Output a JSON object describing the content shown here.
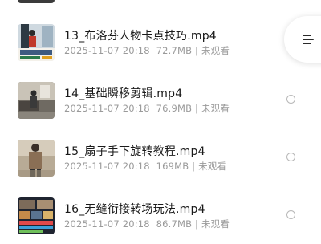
{
  "files": [
    {
      "name": "13_布洛芬人物卡点技巧.mp4",
      "date": "2025-11-07 20:18",
      "size": "72.7MB",
      "status": "未观看",
      "thumbnail": "video-thumbnail"
    },
    {
      "name": "14_基础瞬移剪辑.mp4",
      "date": "2025-11-07 20:18",
      "size": "76.9MB",
      "status": "未观看",
      "thumbnail": "video-thumbnail"
    },
    {
      "name": "15_扇子手下旋转教程.mp4",
      "date": "2025-11-07 20:18",
      "size": "169MB",
      "status": "未观看",
      "thumbnail": "video-thumbnail"
    },
    {
      "name": "16_无缝衔接转场玩法.mp4",
      "date": "2025-11-07 20:18",
      "size": "86.7MB",
      "status": "未观看",
      "thumbnail": "video-thumbnail"
    }
  ],
  "menu_button": {
    "icon": "menu-icon"
  },
  "colors": {
    "title_text": "#1a1a1a",
    "meta_text": "#9a9a9a",
    "radio_border": "#b8b8b8"
  }
}
